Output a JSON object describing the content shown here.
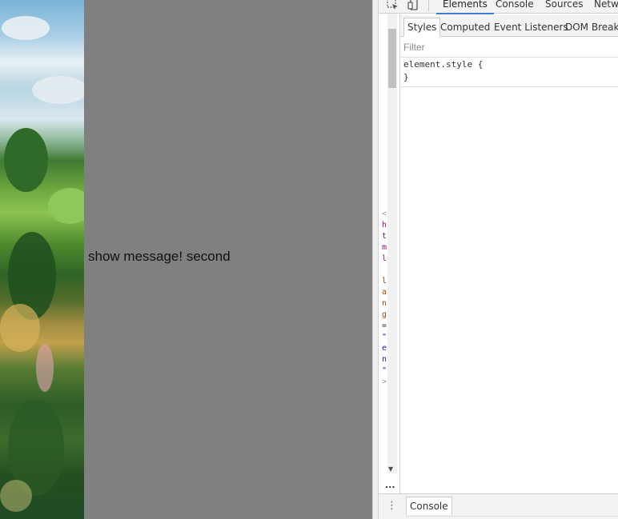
{
  "page": {
    "message": "show message! second",
    "panel_color": "#808080"
  },
  "devtools": {
    "tools": [
      {
        "icon": "inspect-element-icon"
      },
      {
        "icon": "device-mode-icon"
      }
    ],
    "main_tabs": [
      "Elements",
      "Console",
      "Sources",
      "Netwo"
    ],
    "active_main_tab": "Elements",
    "tree_fragments": [
      "<",
      "h",
      "t",
      "m",
      "l",
      "l",
      "a",
      "n",
      "g",
      "=",
      "\"",
      "e",
      "n",
      "\"",
      ">"
    ],
    "sub_tabs": [
      "Styles",
      "Computed",
      "Event Listeners",
      "DOM Breakp"
    ],
    "active_sub_tab": "Styles",
    "filter_placeholder": "Filter",
    "rule_selector": "element.style {",
    "rule_close": "}",
    "gutter_ellipsis": "...",
    "drawer_tab": "Console",
    "accent_color": "#3879d9"
  }
}
